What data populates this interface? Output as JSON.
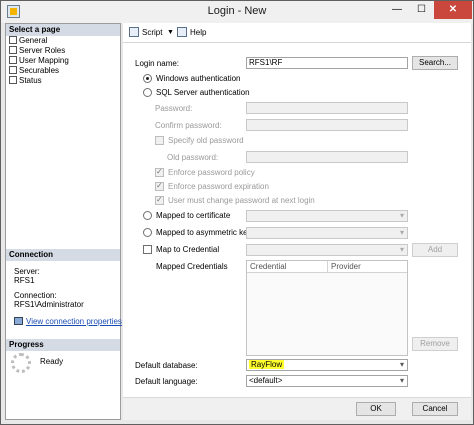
{
  "window": {
    "title": "Login - New",
    "minimize_glyph": "—",
    "maximize_glyph": "☐",
    "close_glyph": "✕"
  },
  "sidebar": {
    "select_page_header": "Select a page",
    "pages": [
      {
        "label": "General",
        "icon": "page-icon"
      },
      {
        "label": "Server Roles",
        "icon": "page-icon"
      },
      {
        "label": "User Mapping",
        "icon": "page-icon"
      },
      {
        "label": "Securables",
        "icon": "page-icon"
      },
      {
        "label": "Status",
        "icon": "page-icon"
      }
    ],
    "connection_header": "Connection",
    "server_label": "Server:",
    "server_value": "RFS1",
    "connection_label": "Connection:",
    "connection_value": "RFS1\\Administrator",
    "view_connection_link": "View connection properties",
    "progress_header": "Progress",
    "progress_status": "Ready"
  },
  "toolbar": {
    "script_label": "Script",
    "help_label": "Help"
  },
  "form": {
    "login_name_label": "Login name:",
    "login_name_value": "RFS1\\RF",
    "search_button": "Search...",
    "windows_auth_label": "Windows authentication",
    "sql_auth_label": "SQL Server authentication",
    "password_label": "Password:",
    "confirm_password_label": "Confirm password:",
    "specify_old_password_label": "Specify old password",
    "old_password_label": "Old password:",
    "enforce_policy_label": "Enforce password policy",
    "enforce_expiration_label": "Enforce password expiration",
    "must_change_label": "User must change password at next login",
    "mapped_cert_label": "Mapped to certificate",
    "mapped_asym_label": "Mapped to asymmetric key",
    "map_credential_label": "Map to Credential",
    "add_button": "Add",
    "mapped_credentials_label": "Mapped Credentials",
    "grid_col_credential": "Credential",
    "grid_col_provider": "Provider",
    "remove_button": "Remove",
    "default_database_label": "Default database:",
    "default_database_value": "RayFlow",
    "default_language_label": "Default language:",
    "default_language_value": "<default>"
  },
  "footer": {
    "ok_button": "OK",
    "cancel_button": "Cancel"
  },
  "colors": {
    "highlight": "#ffff2e",
    "link": "#1a4db3",
    "close_button": "#c9473c"
  }
}
